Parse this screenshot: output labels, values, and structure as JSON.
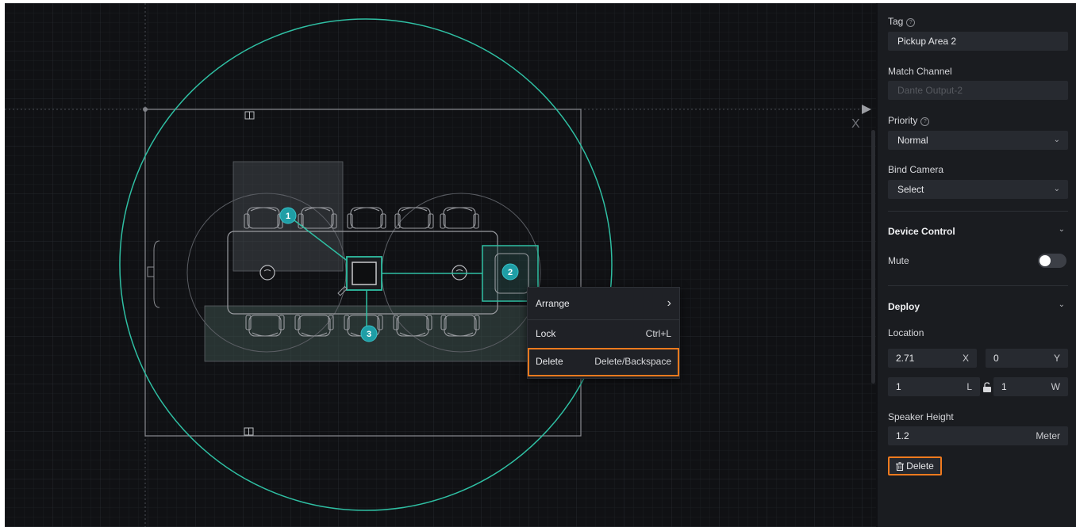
{
  "canvas": {
    "axis_label": "X",
    "seat_markers": [
      "1",
      "2",
      "3"
    ]
  },
  "context_menu": {
    "items": [
      {
        "label": "Arrange",
        "shortcut": "›"
      },
      {
        "label": "Lock",
        "shortcut": "Ctrl+L"
      },
      {
        "label": "Delete",
        "shortcut": "Delete/Backspace"
      }
    ]
  },
  "panel": {
    "tag_label": "Tag",
    "tag_value": "Pickup Area 2",
    "match_channel_label": "Match Channel",
    "match_channel_value": "Dante Output-2",
    "priority_label": "Priority",
    "priority_value": "Normal",
    "bind_camera_label": "Bind Camera",
    "bind_camera_value": "Select",
    "device_control_title": "Device Control",
    "mute_label": "Mute",
    "mute_on": false,
    "deploy_title": "Deploy",
    "location_label": "Location",
    "location": {
      "x_value": "2.71",
      "x_unit": "X",
      "y_value": "0",
      "y_unit": "Y",
      "l_value": "1",
      "l_unit": "L",
      "w_value": "1",
      "w_unit": "W"
    },
    "speaker_height_label": "Speaker Height",
    "speaker_height_value": "1.2",
    "speaker_height_unit": "Meter",
    "delete_label": "Delete"
  },
  "colors": {
    "accent_teal": "#2fbfa3",
    "marker_teal": "#1f9ea6",
    "highlight_orange": "#f07a1e"
  }
}
